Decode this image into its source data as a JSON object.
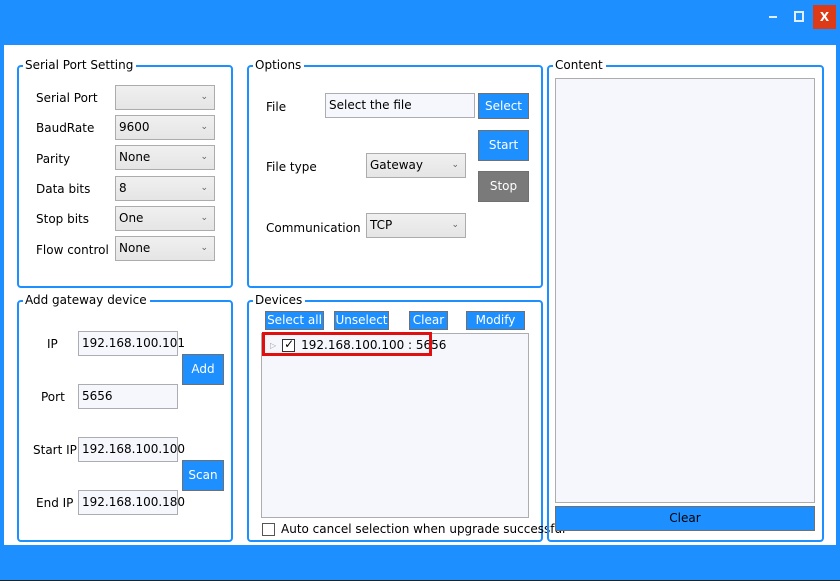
{
  "window": {
    "minimize_icon": "minimize-icon",
    "maximize_icon": "maximize-icon",
    "close_label": "X"
  },
  "serial_port": {
    "title": "Serial Port Setting",
    "fields": [
      {
        "label": "Serial Port",
        "value": ""
      },
      {
        "label": "BaudRate",
        "value": "9600"
      },
      {
        "label": "Parity",
        "value": "None"
      },
      {
        "label": "Data bits",
        "value": "8"
      },
      {
        "label": "Stop bits",
        "value": "One"
      },
      {
        "label": "Flow control",
        "value": "None"
      }
    ],
    "dropdown_icon": "chevron-down-icon"
  },
  "options": {
    "title": "Options",
    "file_label": "File",
    "file_value": "Select the file",
    "select_button": "Select",
    "start_button": "Start",
    "stop_button": "Stop",
    "file_type_label": "File type",
    "file_type_value": "Gateway",
    "communication_label": "Communication",
    "communication_value": "TCP"
  },
  "add_gateway": {
    "title": "Add gateway device",
    "ip_label": "IP",
    "ip_value": "192.168.100.101",
    "port_label": "Port",
    "port_value": "5656",
    "add_button": "Add",
    "start_ip_label": "Start IP",
    "start_ip_value": "192.168.100.100",
    "end_ip_label": "End IP",
    "end_ip_value": "192.168.100.180",
    "scan_button": "Scan"
  },
  "devices": {
    "title": "Devices",
    "buttons": {
      "select_all": "Select all",
      "unselect": "Unselect",
      "clear": "Clear",
      "modify": "Modify"
    },
    "items": [
      {
        "label": "192.168.100.100 : 5656",
        "checked": true,
        "highlighted": true
      }
    ],
    "auto_cancel_label": "Auto cancel selection when upgrade successful",
    "auto_cancel_checked": false
  },
  "content": {
    "title": "Content",
    "text": "",
    "clear_button": "Clear"
  },
  "colors": {
    "accent": "#1e8fff",
    "close": "#dd3a17",
    "stop_button": "#7a7a7a",
    "highlight": "#e01010"
  }
}
